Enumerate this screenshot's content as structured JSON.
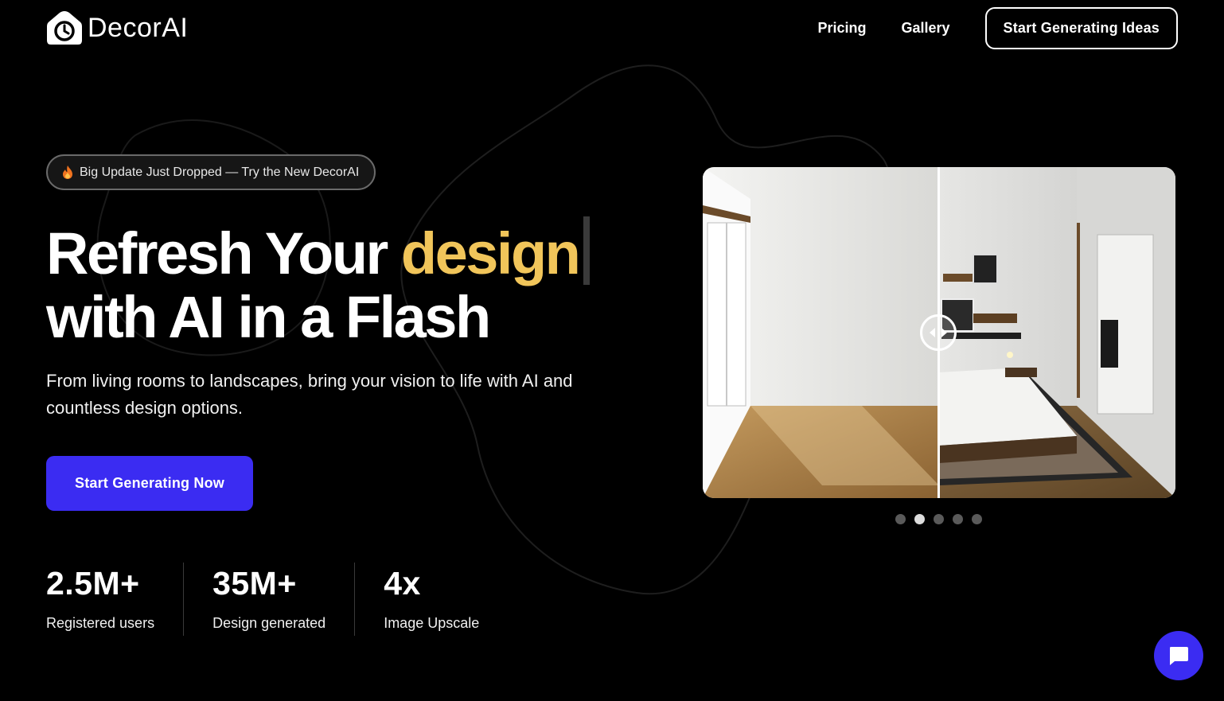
{
  "brand": {
    "name": "DecorAI",
    "logo_icon": "camera-clock-icon"
  },
  "nav": {
    "links": [
      {
        "label": "Pricing"
      },
      {
        "label": "Gallery"
      }
    ],
    "cta_label": "Start Generating Ideas"
  },
  "hero": {
    "badge": {
      "icon": "fire-icon",
      "text": "Big Update Just Dropped — Try the New DecorAI"
    },
    "headline": {
      "line1_start": "Refresh Your ",
      "line1_accent": "design",
      "line2": "with AI in a Flash"
    },
    "subtext": "From living rooms to landscapes, bring your vision to life with AI and countless design options.",
    "cta_label": "Start Generating Now"
  },
  "stats": [
    {
      "value": "2.5M+",
      "label": "Registered users"
    },
    {
      "value": "35M+",
      "label": "Design generated"
    },
    {
      "value": "4x",
      "label": "Image Upscale"
    }
  ],
  "carousel": {
    "slide_count": 5,
    "active_index": 1,
    "slider_split": 0.5
  },
  "colors": {
    "accent_yellow": "#f1c55a",
    "primary_blue": "#3b2cf2",
    "background": "#000000"
  },
  "chat": {
    "icon": "chat-bubble-icon"
  }
}
